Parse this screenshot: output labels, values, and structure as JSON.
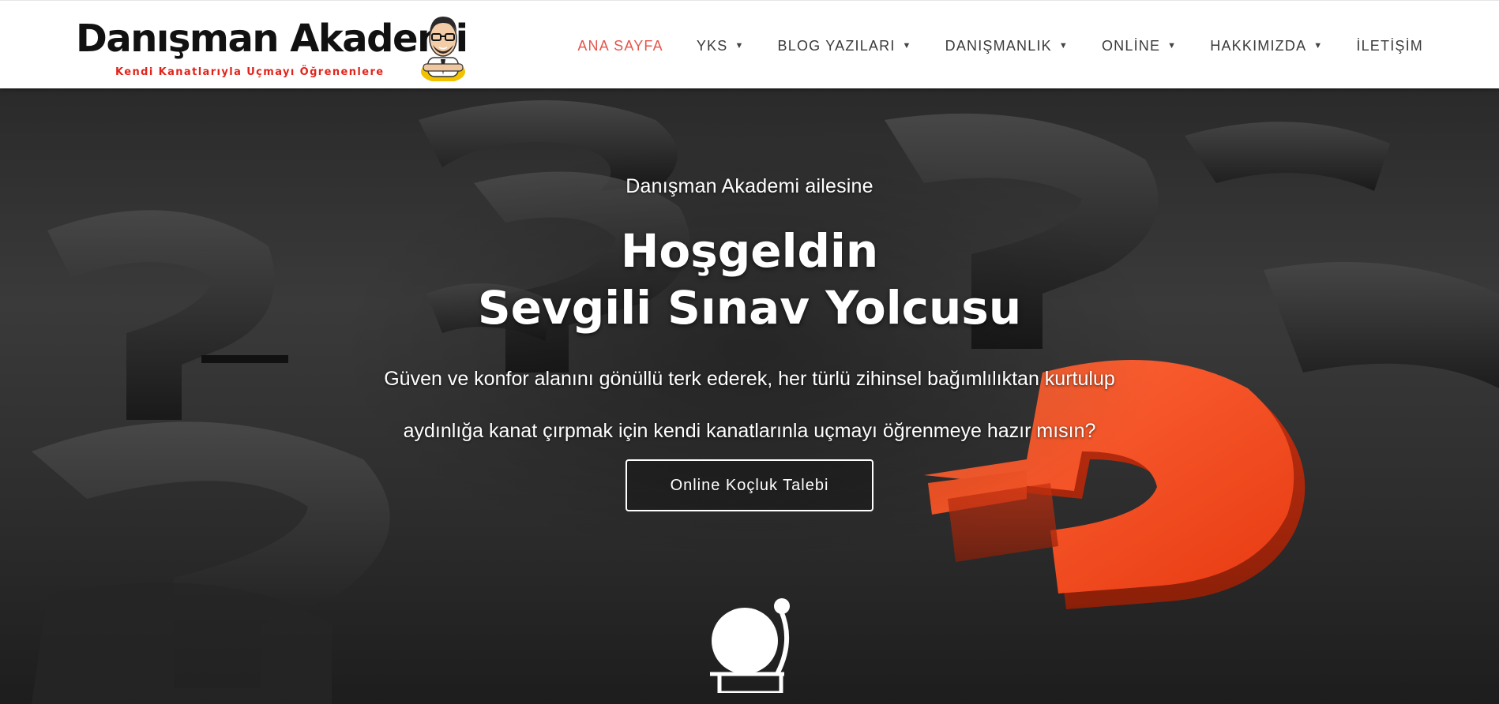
{
  "brand": {
    "name": "Danışman Akademi",
    "tagline": "Kendi Kanatlarıyla Uçmayı Öğrenenlere",
    "mascot": "mascot-cartoon"
  },
  "nav": {
    "items": [
      {
        "label": "ANA SAYFA",
        "active": true,
        "dropdown": false
      },
      {
        "label": "YKS",
        "active": false,
        "dropdown": true
      },
      {
        "label": "BLOG YAZILARI",
        "active": false,
        "dropdown": true
      },
      {
        "label": "DANIŞMANLIK",
        "active": false,
        "dropdown": true
      },
      {
        "label": "ONLİNE",
        "active": false,
        "dropdown": true
      },
      {
        "label": "HAKKIMIZDA",
        "active": false,
        "dropdown": true
      },
      {
        "label": "İLETİŞİM",
        "active": false,
        "dropdown": false
      }
    ],
    "caret": "▼"
  },
  "hero": {
    "intro": "Danışman Akademi ailesine",
    "title_line1": "Hoşgeldin",
    "title_line2": "Sevgili Sınav Yolcusu",
    "text_line1": "Güven ve konfor alanını gönüllü terk ederek,  her türlü zihinsel bağımlılıktan kurtulup",
    "text_line2": "aydınlığa kanat çırpmak için  kendi kanatlarınla uçmayı öğrenmeye hazır mısın?",
    "cta_label": "Online Koçluk Talebi",
    "icon": "bell-icon"
  },
  "colors": {
    "accent": "#e4554a",
    "nav_text": "#3a3a3a",
    "tagline": "#e2231a",
    "question_mark": "#f04a1e"
  }
}
